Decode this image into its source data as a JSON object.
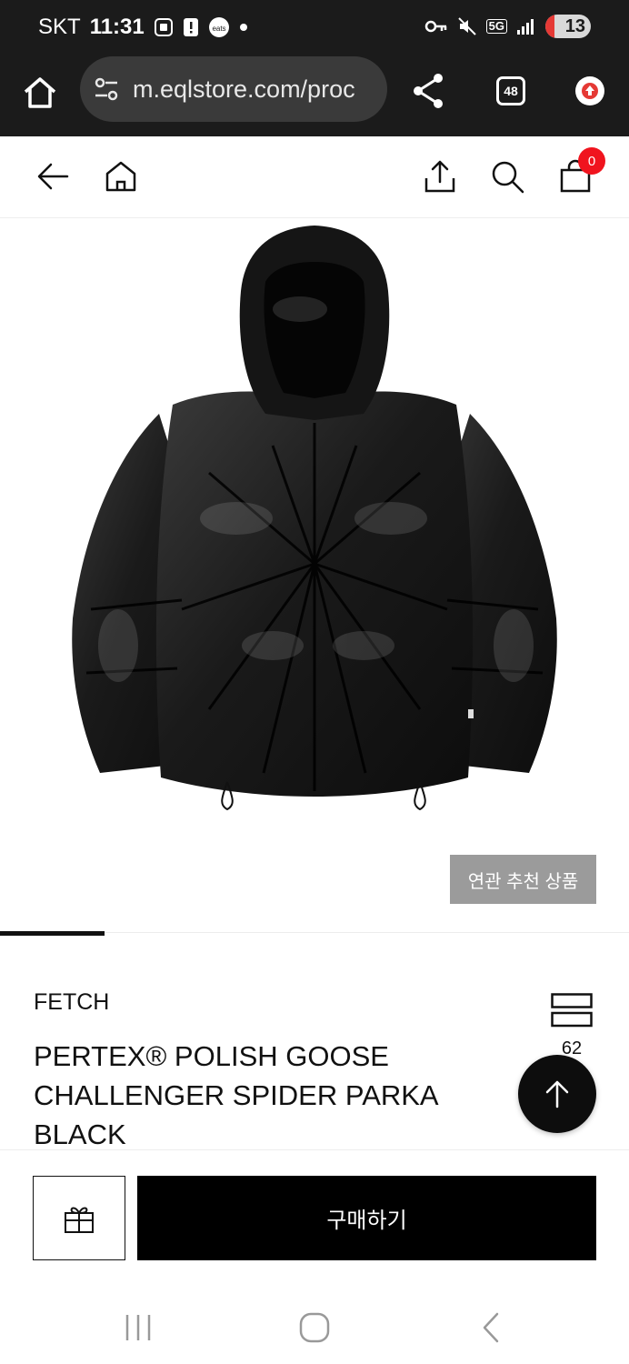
{
  "status_bar": {
    "carrier": "SKT",
    "time": "11:31",
    "network": "5G",
    "battery_level": "13",
    "icons": [
      "screenshot-icon",
      "alert-icon",
      "coupang-eats-icon",
      "dot-icon",
      "key-icon",
      "mute-icon",
      "signal-icon"
    ]
  },
  "browser": {
    "url": "m.eqlstore.com/proc",
    "tab_count": "48"
  },
  "header": {
    "cart_count": "0"
  },
  "product": {
    "related_button": "연관 추천 상품",
    "brand": "FETCH",
    "title": "PERTEX® POLISH GOOSE CHALLENGER SPIDER PARKA BLACK",
    "wish_count": "62",
    "gallery_progress": 0.166
  },
  "actions": {
    "buy_label": "구매하기"
  },
  "colors": {
    "accent_badge": "#f0141e",
    "related_button_bg": "#9b9b9b",
    "buy_button_bg": "#000000",
    "chrome_bg": "#1b1b1b"
  }
}
